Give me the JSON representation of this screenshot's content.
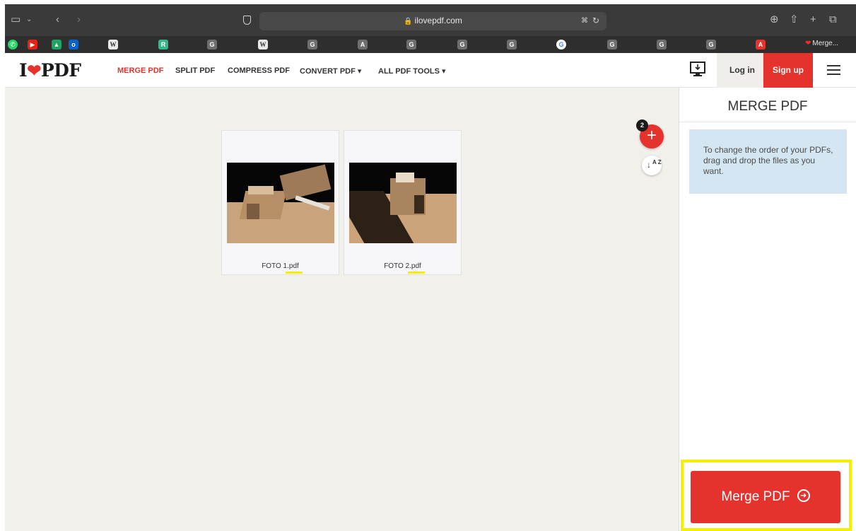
{
  "browser": {
    "url": "ilovepdf.com",
    "tab_title": "Merge..."
  },
  "header": {
    "logo_text_left": "I",
    "logo_text_right": "PDF",
    "nav": {
      "merge": "MERGE PDF",
      "split": "SPLIT PDF",
      "compress": "COMPRESS PDF",
      "convert": "CONVERT PDF ▾",
      "all_tools": "ALL PDF TOOLS ▾"
    },
    "login": "Log in",
    "signup": "Sign up"
  },
  "workspace": {
    "file_count": "2",
    "files": [
      {
        "name": "FOTO 1.pdf"
      },
      {
        "name": "FOTO 2.pdf"
      }
    ],
    "add_symbol": "+",
    "sort_az": "A Z"
  },
  "sidebar": {
    "title": "MERGE PDF",
    "info": "To change the order of your PDFs, drag and drop the files as you want.",
    "merge_button": "Merge PDF"
  },
  "colors": {
    "brand_red": "#e5322d",
    "info_blue": "#d4e6f1",
    "highlight_yellow": "#f5f000",
    "workspace_bg": "#f2f0eb"
  }
}
